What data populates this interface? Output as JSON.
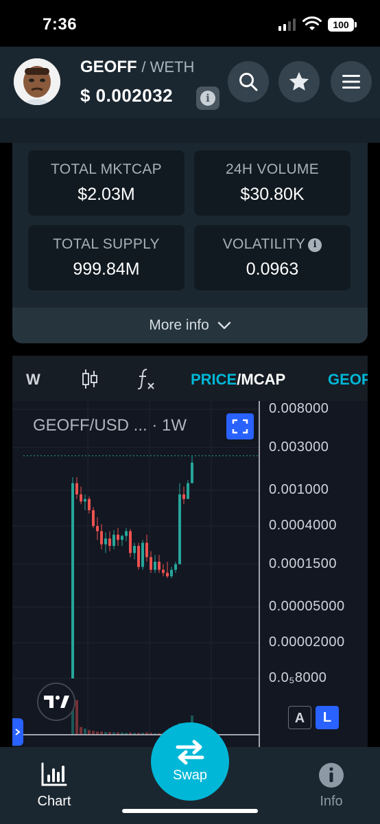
{
  "status_bar": {
    "time": "7:36",
    "battery": "100"
  },
  "header": {
    "base_symbol": "GEOFF",
    "quote_symbol": "/ WETH",
    "price": "$ 0.002032",
    "info_icon": "i",
    "buttons": [
      "search-icon",
      "star-icon",
      "menu-icon"
    ]
  },
  "stats": {
    "total_mktcap": {
      "label": "TOTAL MKTCAP",
      "value": "$2.03M"
    },
    "volume_24h": {
      "label": "24H VOLUME",
      "value": "$30.80K"
    },
    "total_supply": {
      "label": "TOTAL SUPPLY",
      "value": "999.84M"
    },
    "volatility": {
      "label": "VOLATILITY",
      "value": "0.0963"
    },
    "more_info": "More info"
  },
  "chart_toolbar": {
    "interval": "W",
    "price_label": "PRICE",
    "separator": "/",
    "mcap_label": "MCAP",
    "token_tab": "GEOF"
  },
  "chart": {
    "legend": "GEOFF/USD ...",
    "interval_badge": "· 1W",
    "scale_auto": "A",
    "scale_log": "L"
  },
  "chart_data": {
    "type": "candlestick",
    "title": "GEOFF/USD",
    "interval": "1W",
    "scale": "log",
    "y_tick_labels": [
      "0.008000",
      "0.003000",
      "0.001000",
      "0.0004000",
      "0.0001500",
      "0.00005000",
      "0.00002000",
      "0.0₅8000"
    ],
    "last_price": 0.002032,
    "candles": [
      {
        "o": 8e-06,
        "h": 0.0014,
        "l": 8e-06,
        "c": 0.0012
      },
      {
        "o": 0.0012,
        "h": 0.0014,
        "l": 0.0008,
        "c": 0.0009
      },
      {
        "o": 0.0009,
        "h": 0.0011,
        "l": 0.0007,
        "c": 0.00075
      },
      {
        "o": 0.00075,
        "h": 0.0009,
        "l": 0.0006,
        "c": 0.0008
      },
      {
        "o": 0.0008,
        "h": 0.00085,
        "l": 0.00055,
        "c": 0.0006
      },
      {
        "o": 0.0006,
        "h": 0.00065,
        "l": 0.00038,
        "c": 0.0004
      },
      {
        "o": 0.0004,
        "h": 0.0005,
        "l": 0.00028,
        "c": 0.00035
      },
      {
        "o": 0.00035,
        "h": 0.00042,
        "l": 0.00022,
        "c": 0.00025
      },
      {
        "o": 0.00025,
        "h": 0.00034,
        "l": 0.0002,
        "c": 0.00029
      },
      {
        "o": 0.00029,
        "h": 0.00035,
        "l": 0.00021,
        "c": 0.00024
      },
      {
        "o": 0.00024,
        "h": 0.00036,
        "l": 0.00022,
        "c": 0.00032
      },
      {
        "o": 0.00032,
        "h": 0.00038,
        "l": 0.00024,
        "c": 0.00028
      },
      {
        "o": 0.00028,
        "h": 0.00032,
        "l": 0.00024,
        "c": 0.00031
      },
      {
        "o": 0.00031,
        "h": 0.00038,
        "l": 0.00027,
        "c": 0.00035
      },
      {
        "o": 0.00035,
        "h": 0.00037,
        "l": 0.00018,
        "c": 0.0002
      },
      {
        "o": 0.0002,
        "h": 0.00026,
        "l": 0.00017,
        "c": 0.00024
      },
      {
        "o": 0.00024,
        "h": 0.00026,
        "l": 0.00013,
        "c": 0.00014
      },
      {
        "o": 0.00014,
        "h": 0.00028,
        "l": 0.00013,
        "c": 0.00026
      },
      {
        "o": 0.00026,
        "h": 0.00032,
        "l": 0.00016,
        "c": 0.00018
      },
      {
        "o": 0.00018,
        "h": 0.00021,
        "l": 0.00012,
        "c": 0.00013
      },
      {
        "o": 0.00013,
        "h": 0.00019,
        "l": 0.00012,
        "c": 0.00016
      },
      {
        "o": 0.00016,
        "h": 0.00019,
        "l": 0.00012,
        "c": 0.00013
      },
      {
        "o": 0.00013,
        "h": 0.00015,
        "l": 0.00011,
        "c": 0.00012
      },
      {
        "o": 0.00012,
        "h": 0.00016,
        "l": 0.000105,
        "c": 0.00011
      },
      {
        "o": 0.00011,
        "h": 0.00014,
        "l": 0.000105,
        "c": 0.00013
      },
      {
        "o": 0.00013,
        "h": 0.00016,
        "l": 0.00012,
        "c": 0.00015
      },
      {
        "o": 0.00015,
        "h": 0.0012,
        "l": 0.00015,
        "c": 0.0009
      },
      {
        "o": 0.0009,
        "h": 0.0011,
        "l": 0.0007,
        "c": 0.0008
      },
      {
        "o": 0.0008,
        "h": 0.0013,
        "l": 0.0008,
        "c": 0.0012
      },
      {
        "o": 0.0012,
        "h": 0.0024,
        "l": 0.0012,
        "c": 0.002032
      }
    ],
    "volume": [
      100,
      90,
      20,
      16,
      12,
      10,
      8,
      8,
      7,
      7,
      6,
      6,
      6,
      5,
      6,
      5,
      5,
      5,
      6,
      5,
      4,
      4,
      5,
      4,
      5,
      6,
      30,
      10,
      14,
      50
    ]
  },
  "colors": {
    "up": "#26a69a",
    "down": "#ef5350",
    "accent": "#00b7d7",
    "tv_blue": "#2962ff"
  },
  "bottom_nav": {
    "chart_label": "Chart",
    "swap_label": "Swap",
    "info_label": "Info"
  }
}
